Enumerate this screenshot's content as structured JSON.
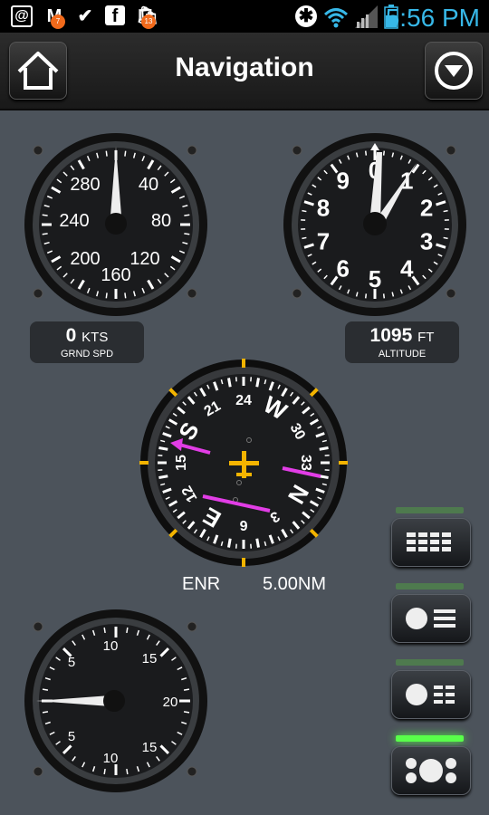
{
  "status_bar": {
    "time": "5:56 PM",
    "icons": [
      "at-sign-icon",
      "gmail-icon",
      "checkmark-app-icon",
      "facebook-icon",
      "shopping-bag-icon",
      "bluetooth-icon",
      "wifi-icon",
      "signal-icon",
      "battery-icon"
    ],
    "badges": {
      "gmail": "7",
      "shop": "13"
    }
  },
  "header": {
    "title": "Navigation",
    "home_icon": "home-icon",
    "menu_icon": "dropdown-circle-icon"
  },
  "airspeed": {
    "labels": [
      "280",
      "40",
      "240",
      "80",
      "200",
      "120",
      "160"
    ],
    "value": "0",
    "unit": "KTS",
    "caption": "GRND SPD"
  },
  "altimeter": {
    "labels": [
      "0",
      "1",
      "2",
      "3",
      "4",
      "5",
      "6",
      "7",
      "8",
      "9"
    ],
    "value": "1095",
    "unit": "FT",
    "caption": "ALTITUDE"
  },
  "hsi": {
    "labels": [
      "24",
      "W",
      "30",
      "33",
      "N",
      "3",
      "6",
      "E",
      "12",
      "15",
      "S",
      "21"
    ],
    "mode": "ENR",
    "scale": "5.00NM"
  },
  "vsi": {
    "labels": [
      "10",
      "15",
      "5",
      "20",
      "5",
      "10",
      "15"
    ]
  },
  "side_buttons": [
    {
      "name": "table-layout-button",
      "icon": "grid-icon",
      "active": false
    },
    {
      "name": "list-layout-button",
      "icon": "dot-list-icon",
      "active": false
    },
    {
      "name": "detail-layout-button",
      "icon": "dot-grid-icon",
      "active": false
    },
    {
      "name": "gauges-layout-button",
      "icon": "circles-icon",
      "active": true
    }
  ],
  "colors": {
    "accent": "#37b8e8",
    "course": "#e23de6",
    "plane": "#f5b400",
    "active_led": "#59ff4a",
    "led": "#4e7a4e"
  }
}
